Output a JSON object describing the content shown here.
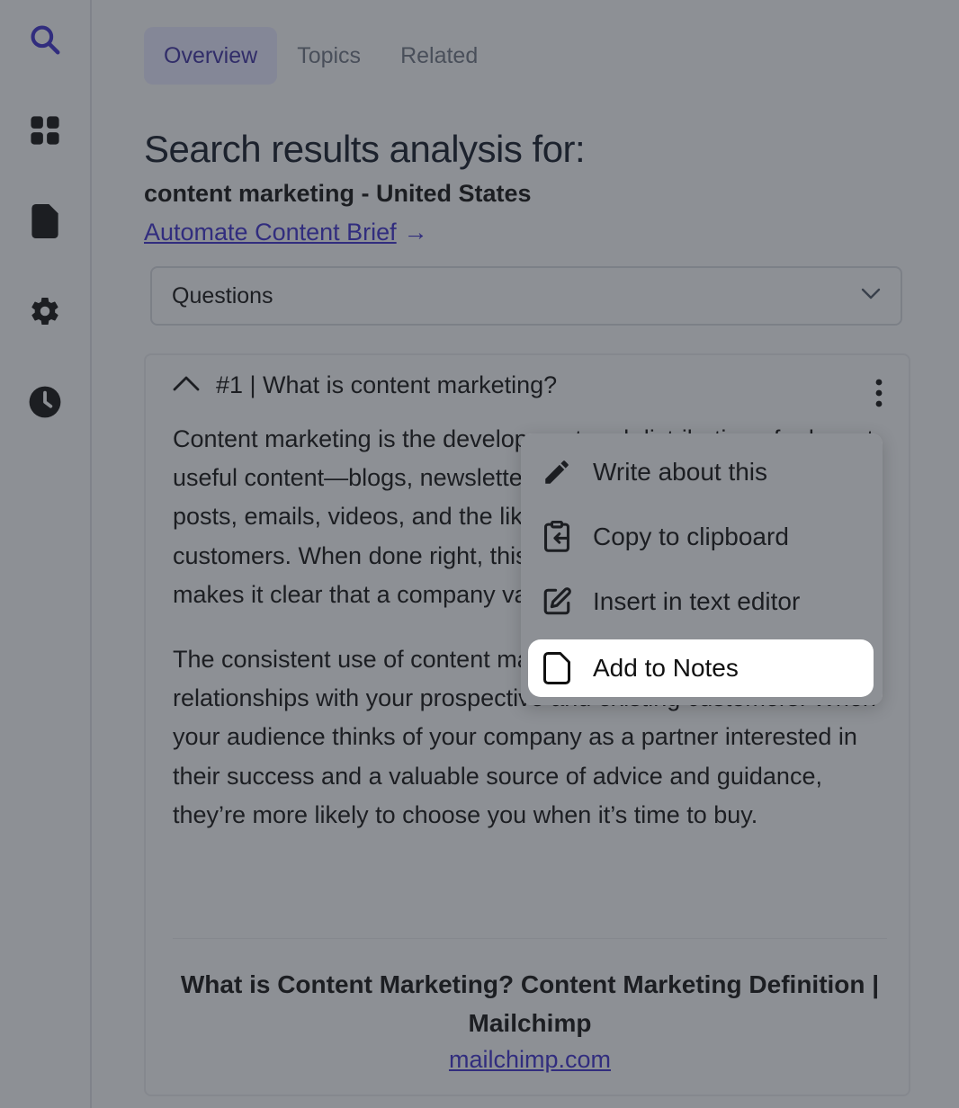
{
  "sidebar": {
    "items": [
      {
        "icon": "search-icon",
        "active": true
      },
      {
        "icon": "grid-icon"
      },
      {
        "icon": "document-icon"
      },
      {
        "icon": "gear-icon"
      },
      {
        "icon": "clock-icon"
      }
    ]
  },
  "tabs": [
    {
      "label": "Overview",
      "active": true
    },
    {
      "label": "Topics"
    },
    {
      "label": "Related"
    }
  ],
  "header": {
    "title": "Search results analysis for:",
    "query": "content marketing - United States",
    "brief_link": "Automate Content Brief",
    "brief_arrow": "→"
  },
  "filter": {
    "selected": "Questions",
    "icon": "chevron-down-icon"
  },
  "question": {
    "title": "#1 | What is content marketing?",
    "paragraphs": [
      "Content marketing is the development and distribution of relevant, useful content—blogs, newsletters, white papers, social media posts, emails, videos, and the like—to current and potential customers. When done right, this content conveys expertise and makes it clear that a company values the people to whom it sells.",
      "The consistent use of content marketing establishes and nurtures relationships with your prospective and existing customers. When your audience thinks of your company as a partner interested in their success and a valuable source of advice and guidance, they’re more likely to choose you when it’s time to buy."
    ],
    "source_title": "What is Content Marketing? Content Marketing Definition | Mailchimp",
    "source_link": "mailchimp.com"
  },
  "context_menu": {
    "items": [
      {
        "label": "Write about this",
        "icon": "pencil-icon"
      },
      {
        "label": "Copy to clipboard",
        "icon": "clipboard-icon"
      },
      {
        "label": "Insert in text editor",
        "icon": "edit-square-icon"
      },
      {
        "label": "Add to Notes",
        "icon": "note-icon",
        "highlighted": true
      }
    ]
  },
  "colors": {
    "accent": "#3b2fc9",
    "tab_active_bg": "#e1e3fb",
    "overlay": "rgba(40,44,52,0.5)"
  }
}
